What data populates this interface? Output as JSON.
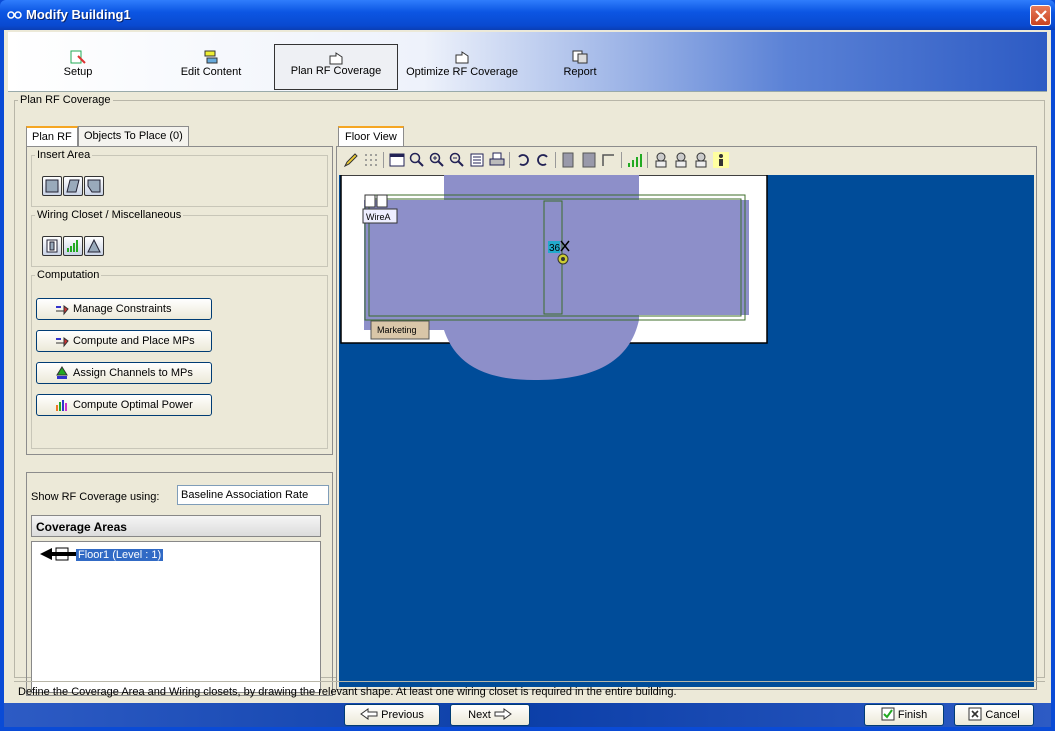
{
  "window": {
    "title": "Modify Building1"
  },
  "wizard": {
    "steps": [
      {
        "label": "Setup"
      },
      {
        "label": "Edit Content"
      },
      {
        "label": "Plan RF Coverage"
      },
      {
        "label": "Optimize RF Coverage"
      },
      {
        "label": "Report"
      }
    ],
    "active_index": 2
  },
  "main_group": {
    "title": "Plan RF Coverage"
  },
  "left_tabs": [
    {
      "label": "Plan RF"
    },
    {
      "label": "Objects To Place (0)"
    }
  ],
  "insert_area": {
    "title": "Insert Area"
  },
  "wiring": {
    "title": "Wiring Closet / Miscellaneous"
  },
  "computation": {
    "title": "Computation",
    "buttons": [
      {
        "label": "Manage Constraints"
      },
      {
        "label": "Compute and Place MPs"
      },
      {
        "label": "Assign Channels to MPs"
      },
      {
        "label": "Compute Optimal Power"
      }
    ]
  },
  "show_rf": {
    "label": "Show RF Coverage using:",
    "value": "Baseline Association Rate"
  },
  "coverage_areas": {
    "header": "Coverage Areas",
    "items": [
      {
        "label": "Floor1 (Level : 1)"
      }
    ]
  },
  "floor_view": {
    "tab": "Floor View",
    "labels": {
      "wiring_closet": "WireA",
      "area": "Marketing",
      "mp_number": "36"
    }
  },
  "status_text": "Define the Coverage Area and Wiring closets, by drawing the relevant shape. At least one wiring closet is required in the entire building.",
  "nav": {
    "previous": "Previous",
    "next": "Next",
    "finish": "Finish",
    "cancel": "Cancel"
  },
  "colors": {
    "canvas": "#004c99",
    "coverage": "#8d8fc9",
    "titlebar": "#0a4bd6"
  }
}
